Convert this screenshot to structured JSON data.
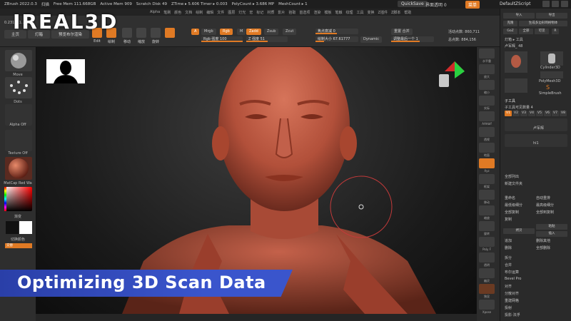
{
  "logo": {
    "text": "IREAL3D"
  },
  "titlebar": {
    "app": "ZBrush 2022.0.3",
    "menu": "扫描",
    "free_mem": "Free Mem 111.668GB",
    "active_mem": "Active Mem 909",
    "scratch": "Scratch Disk 49",
    "ztime": "ZTime ▸ 5.606 Timer ▸ 0.003",
    "polycount": "PolyCount ▸ 3.686 MP",
    "meshcount": "MeshCount ▸ 1",
    "quicksave": "QuickSave",
    "transparency": "界面透明 0",
    "menus_btn": "菜单",
    "script": "DefaultZScript"
  },
  "menubar": {
    "items": [
      "Alpha",
      "笔刷",
      "颜色",
      "文档",
      "绘制",
      "编辑",
      "文件",
      "图层",
      "灯光",
      "宏",
      "标记",
      "材质",
      "影片",
      "拾取",
      "首选项",
      "渲染",
      "模板",
      "笔触",
      "纹理",
      "工具",
      "变换",
      "Z插件",
      "Z脚本",
      "帮助"
    ]
  },
  "toolbar": {
    "coords": "0.231,0.1...",
    "tab_home": "主页",
    "tab_lightbox": "灯箱",
    "tab_preview": "预览布尔渲染",
    "edit_label": "Edit",
    "draw_label": "绘制",
    "move_label": "移动",
    "scale_label": "缩放",
    "rotate_label": "旋转",
    "a_label": "A",
    "mrgb": "Mrgb",
    "rgb": "Rgb",
    "m": "M",
    "zadd": "Zadd",
    "zsub": "Zsub",
    "zcut": "Zcut",
    "rgb_intensity": "Rgb 强度 100",
    "z_intensity": "Z 强度 51",
    "focal_shift": "焦点衰减 0",
    "draw_size": "绘制大小 67.61777",
    "dynamic": "Dynamic",
    "active_points": "活动点数: 860,711",
    "total_points": "总点数: 884,156",
    "mirror_weld": "重置 合并",
    "adjust_last": "调整最后一个 1"
  },
  "leftshelf": {
    "move": "Move",
    "dots": "Dots",
    "alpha_off": "Alpha Off",
    "texture_off": "Texture Off",
    "material": "MatCap Red Wa",
    "gradient": "渐变",
    "switch_color": "切换颜色",
    "alternate": "交替"
  },
  "rightpanel": {
    "import": "导入",
    "export": "导出",
    "clone": "克隆",
    "make_polymesh": "生成多边形网格物体",
    "goz": "GoZ",
    "all": "全部",
    "visible": "可见",
    "r": "R",
    "lightbox_tools": "灯箱 ▸ 工具",
    "current_tool": "卢军辉_ 48",
    "cylinder": "Cylinder3D",
    "polymesh": "PolyMesh3D",
    "simplebrush": "SimpleBrush",
    "subtool_header": "子工具",
    "subtool_count": "子工具可见数量 4",
    "v_tabs": [
      "V1",
      "V2",
      "V3",
      "V4",
      "V5",
      "V6",
      "V7",
      "V8"
    ],
    "subtool_a": "卢军辉",
    "subtool_b": "hi1",
    "list_all": "全部列出",
    "new_folder": "新建文件夹",
    "rename": "重命名",
    "auto_reorder": "自动重排",
    "all_low": "最低级细分",
    "all_high": "最高级细分",
    "all_copy": "全部复制",
    "all_to_dup": "全部到复制",
    "copy": "复制",
    "paste": "粘贴",
    "duplicate": "拷贝",
    "append": "追加",
    "insert": "插入",
    "delete": "删除",
    "delete_other": "删除其他",
    "delete_all": "全部删除",
    "split": "拆分",
    "merge": "合并",
    "boolean": "布尔运算",
    "bevel_pro": "Bevel Pro",
    "align": "对齐",
    "distribute": "分散对齐",
    "remesh": "重建网格",
    "project": "投射",
    "extract": "投影·法浮"
  },
  "rightstrip": {
    "labels": [
      "水平重",
      "放大",
      "缩小",
      "实际",
      "AAHalf",
      "透视",
      "地面",
      "Xyz",
      "框架",
      "移动",
      "缩放",
      "旋转",
      "Poly F",
      "透明",
      "幽灵",
      "独显",
      "Xpose"
    ]
  },
  "viewport": {
    "accent": "#c45a3e"
  },
  "banner": {
    "text": "Optimizing 3D Scan Data"
  }
}
